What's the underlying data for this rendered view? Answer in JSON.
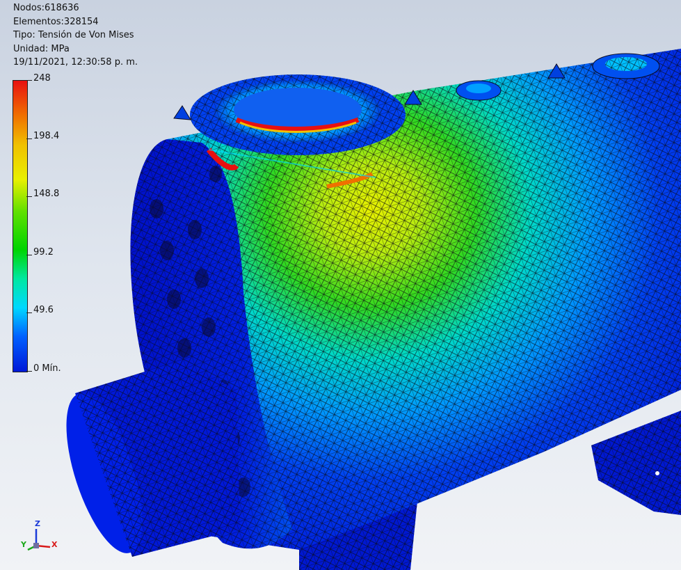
{
  "info": {
    "nodes": "Nodos:618636",
    "elements": "Elementos:328154",
    "type": "Tipo: Tensión de Von Mises",
    "unit": "Unidad: MPa",
    "timestamp": "19/11/2021, 12:30:58 p. m."
  },
  "legend": {
    "ticks": [
      "248",
      "198.4",
      "148.8",
      "99.2",
      "49.6",
      "0 Mín."
    ],
    "colors": {
      "max": "#e81010",
      "orange": "#f07000",
      "yellow": "#e8f000",
      "green": "#00d400",
      "cyan": "#00d8ff",
      "min": "#0018d8"
    }
  },
  "triad": {
    "z": "Z",
    "x": "X",
    "y": "Y"
  }
}
